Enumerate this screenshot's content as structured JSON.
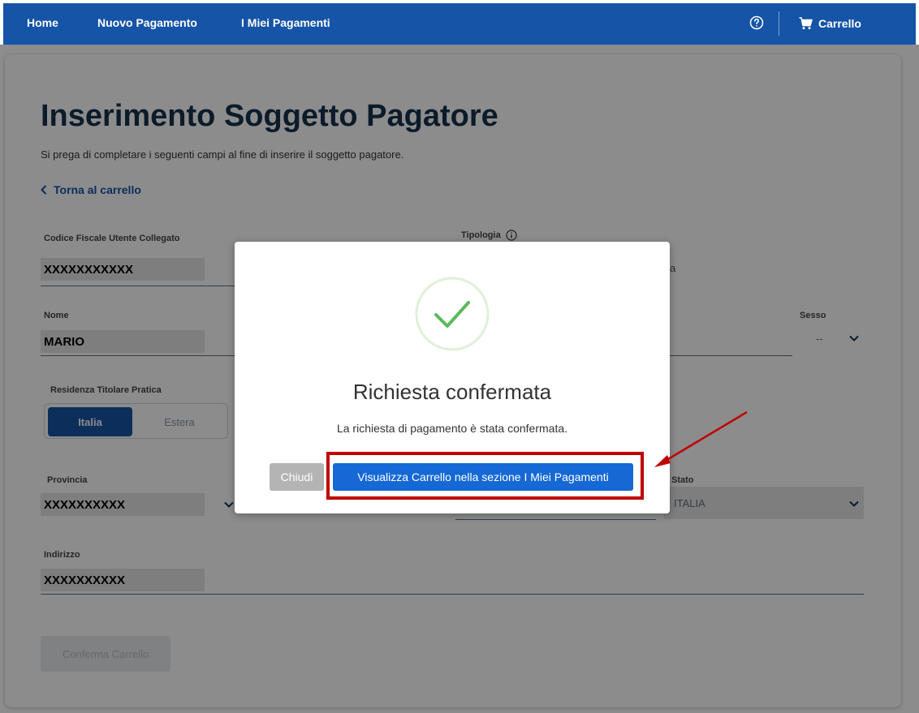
{
  "nav": {
    "home": "Home",
    "new_payment": "Nuovo Pagamento",
    "my_payments": "I Miei Pagamenti",
    "help_icon": "question-circle-icon",
    "cart": "Carrello",
    "cart_icon": "cart-icon"
  },
  "page": {
    "title": "Inserimento Soggetto Pagatore",
    "subtitle": "Si prega di completare i seguenti campi al fine di inserire il soggetto pagatore.",
    "back_link": "Torna al carrello"
  },
  "form": {
    "codice_fiscale_label": "Codice Fiscale Utente Collegato",
    "codice_fiscale_value": "XXXXXXXXXXX",
    "tipologia_label": "Tipologia",
    "tipologia_partial": "a",
    "nome_label": "Nome",
    "nome_value": "MARIO",
    "sesso_label": "Sesso",
    "sesso_value": "--",
    "residenza_label": "Residenza Titolare Pratica",
    "residenza_options": [
      "Italia",
      "Estera"
    ],
    "provincia_label": "Provincia",
    "provincia_value": "XXXXXXXXXX",
    "stato_label": "Stato",
    "stato_value": "ITALIA",
    "indirizzo_label": "Indirizzo",
    "indirizzo_value": "XXXXXXXXXX",
    "confirm_button": "Conferma Carrello"
  },
  "modal": {
    "title": "Richiesta confermata",
    "message": "La richiesta di pagamento è stata confermata.",
    "close_button": "Chiudi",
    "primary_button": "Visualizza Carrello nella sezione I Miei Pagamenti",
    "icon": "check-circle-icon",
    "success_color": "#5cb85c"
  },
  "colors": {
    "brand_blue": "#1554a6",
    "primary_button": "#1669d4",
    "annotation_red": "#c00000"
  }
}
